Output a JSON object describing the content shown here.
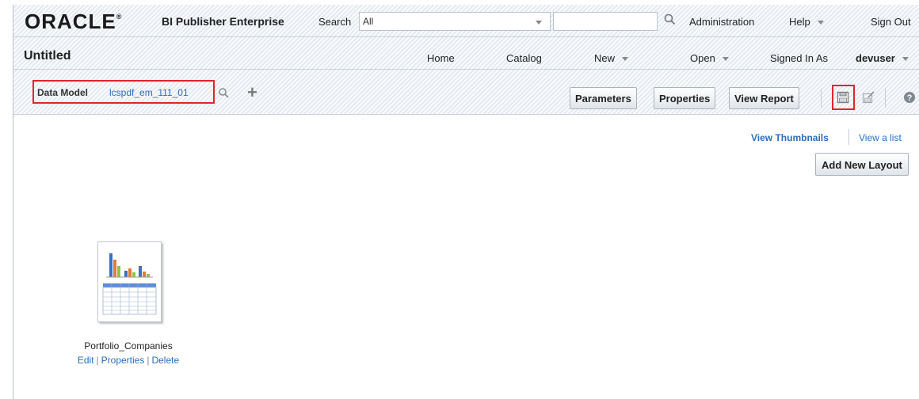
{
  "brand": {
    "logo": "ORACLE",
    "logo_mark": "®",
    "product": "BI Publisher Enterprise"
  },
  "search": {
    "label": "Search",
    "scope": "All",
    "query": ""
  },
  "global_links": {
    "administration": "Administration",
    "help": "Help",
    "sign_out": "Sign Out"
  },
  "header": {
    "title": "Untitled",
    "home": "Home",
    "catalog": "Catalog",
    "new": "New",
    "open": "Open",
    "signed_in_as": "Signed In As",
    "user": "devuser"
  },
  "toolbar": {
    "data_model_label": "Data Model",
    "data_model_value": "lcspdf_em_111_01",
    "parameters": "Parameters",
    "properties": "Properties",
    "view_report": "View Report",
    "icons": [
      "search-icon",
      "plus-icon",
      "save-icon",
      "save-as-icon",
      "help-icon"
    ]
  },
  "layouts": {
    "view_thumbnails": "View Thumbnails",
    "view_list": "View a list",
    "add_new_layout": "Add New Layout",
    "items": [
      {
        "name": "Portfolio_Companies",
        "edit": "Edit",
        "properties": "Properties",
        "delete": "Delete"
      }
    ]
  },
  "colors": {
    "link": "#2a6ebb",
    "highlight": "#e0262c",
    "bar_background": "#eef2f6"
  }
}
